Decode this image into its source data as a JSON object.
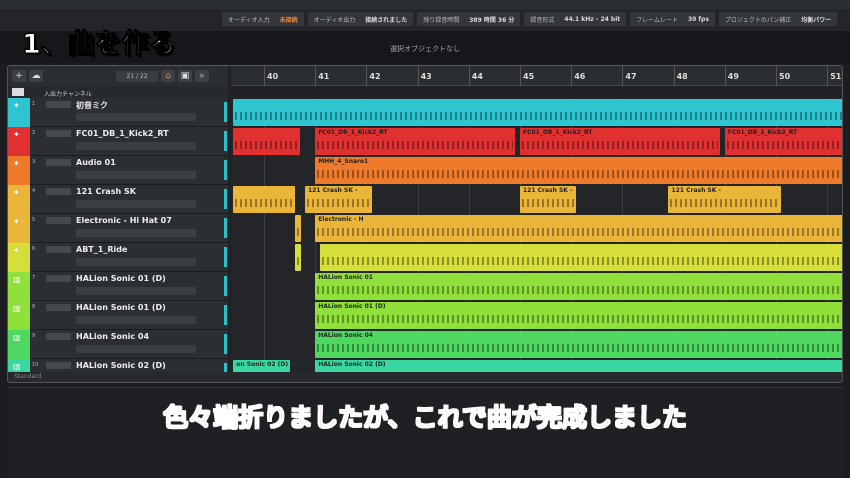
{
  "overlay": {
    "title": "1、曲を作る",
    "subtitle": "色々端折りましたが、これで曲が完成しました"
  },
  "status_bar": [
    {
      "label": "オーディオ入力",
      "value": "未接続",
      "warn": true
    },
    {
      "label": "オーディオ出力",
      "value": "接続されました"
    },
    {
      "label": "残り録音時間",
      "value": "389 時間 36 分"
    },
    {
      "label": "録音形式",
      "value": "44.1 kHz - 24 bit"
    },
    {
      "label": "フレームレート",
      "value": "30 fps"
    },
    {
      "label": "プロジェクトのパン補正",
      "value": "均衡パワー"
    }
  ],
  "info_line": "選択オブジェクトなし",
  "project": {
    "track_count": "21 / 22",
    "input_channel": "入出力チャンネル",
    "footer": "Standard",
    "bars": [
      "40",
      "41",
      "42",
      "43",
      "44",
      "45",
      "46",
      "47",
      "48",
      "49",
      "50",
      "51"
    ],
    "tracks": [
      {
        "num": "1",
        "name": "初音ミク",
        "color": "#2ec4d0"
      },
      {
        "num": "2",
        "name": "FC01_DB_1_Kick2_RT",
        "color": "#e03030"
      },
      {
        "num": "3",
        "name": "Audio 01",
        "color": "#ee7a2a"
      },
      {
        "num": "4",
        "name": "121 Crash SK",
        "color": "#e9b63a"
      },
      {
        "num": "5",
        "name": "Electronic - Hi Hat 07",
        "color": "#e9b63a"
      },
      {
        "num": "6",
        "name": "ABT_1_Ride",
        "color": "#d6de3a"
      },
      {
        "num": "7",
        "name": "HALion Sonic 01 (D)",
        "color": "#8fe03a"
      },
      {
        "num": "8",
        "name": "HALion Sonic 01 (D)",
        "color": "#8fe03a"
      },
      {
        "num": "9",
        "name": "HALion Sonic 04",
        "color": "#4fd860"
      },
      {
        "num": "10",
        "name": "HALion Sonic 02 (D)",
        "color": "#3ad8a0"
      }
    ],
    "clips": [
      [
        {
          "s": 39.4,
          "e": 51.5,
          "label": ""
        }
      ],
      [
        {
          "s": 39.4,
          "e": 40.7,
          "label": ""
        },
        {
          "s": 41,
          "e": 44.9,
          "label": "FC01_DB_1_Kick2_RT"
        },
        {
          "s": 45,
          "e": 48.9,
          "label": "FC01_DB_1_Kick2_RT"
        },
        {
          "s": 49,
          "e": 51.5,
          "label": "FC01_DB_1_Kick2_RT"
        }
      ],
      [
        {
          "s": 41,
          "e": 51.5,
          "label": "MHH_4_Snare1"
        }
      ],
      [
        {
          "s": 39.4,
          "e": 40.6,
          "label": ""
        },
        {
          "s": 40.8,
          "e": 42.1,
          "label": "121 Crash SK -"
        },
        {
          "s": 45,
          "e": 46.1,
          "label": "121 Crash SK -"
        },
        {
          "s": 47.9,
          "e": 50.1,
          "label": "121 Crash SK -"
        }
      ],
      [
        {
          "s": 40.6,
          "e": 40.7,
          "label": ""
        },
        {
          "s": 41,
          "e": 51.5,
          "label": "Electronic - H"
        }
      ],
      [
        {
          "s": 40.6,
          "e": 40.7,
          "label": ""
        },
        {
          "s": 41.1,
          "e": 51.5,
          "label": ""
        }
      ],
      [
        {
          "s": 41,
          "e": 51.5,
          "label": "HALion Sonic 01"
        }
      ],
      [
        {
          "s": 41,
          "e": 51.5,
          "label": "HALion Sonic 01 (D)"
        }
      ],
      [
        {
          "s": 41,
          "e": 51.5,
          "label": "HALion Sonic 04"
        }
      ],
      [
        {
          "s": 39.4,
          "e": 40.5,
          "label": "on Sonic 02 (D)"
        },
        {
          "s": 41,
          "e": 51.5,
          "label": "HALion Sonic 02 (D)"
        }
      ]
    ]
  }
}
